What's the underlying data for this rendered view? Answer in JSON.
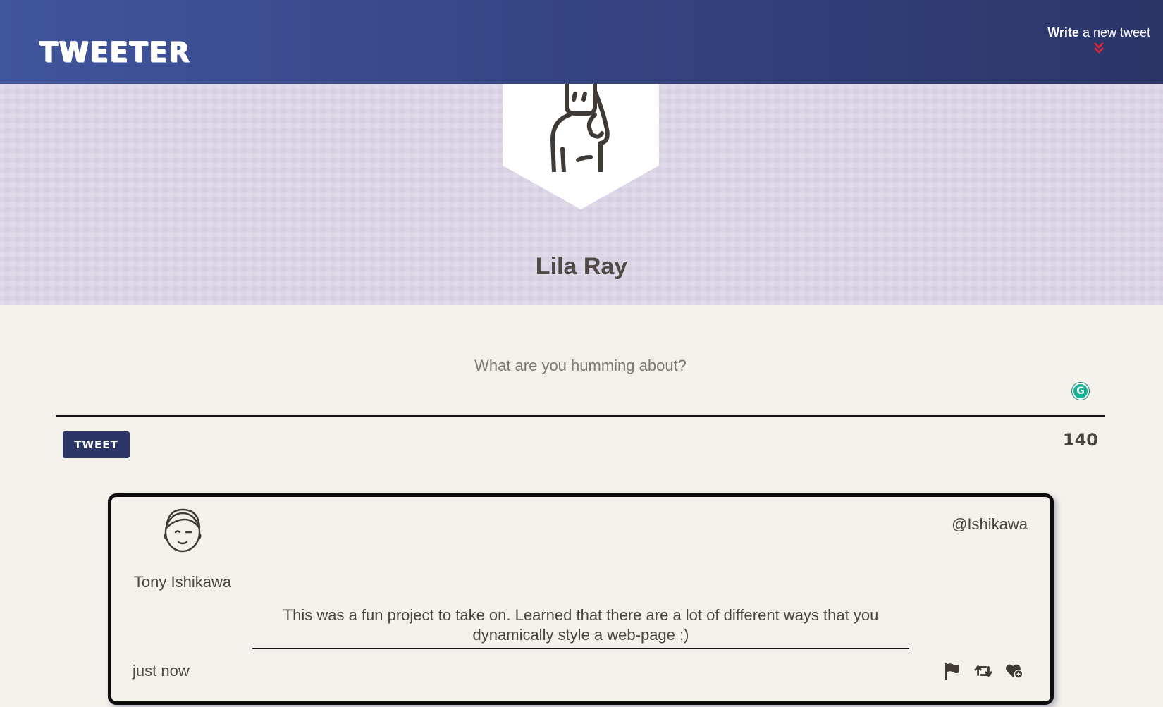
{
  "nav": {
    "brand": "TWEETER",
    "write_bold": "Write",
    "write_rest": " a new tweet",
    "chevron_icon": "double-chevron-down-icon",
    "chevron_color": "#e32636"
  },
  "profile": {
    "name": "Lila Ray",
    "avatar_icon": "woman-avatar-icon"
  },
  "compose": {
    "placeholder": "What are you humming about?",
    "value": "",
    "button_label": "TWEET",
    "counter": "140"
  },
  "tweet": {
    "author_name": "Tony Ishikawa",
    "handle": "@Ishikawa",
    "text": "This was a fun project to take on. Learned that there are a lot of different ways that you dynamically style a web-page :)",
    "timestamp": "just now",
    "actions": [
      "flag-icon",
      "retweet-icon",
      "heart-add-icon"
    ]
  },
  "colors": {
    "nav_start": "#41559d",
    "nav_end": "#2b3568",
    "band": "#ddd6e6",
    "page_bg": "#f4f1ec",
    "button_bg": "#2b3566",
    "accent_red": "#e32636"
  }
}
